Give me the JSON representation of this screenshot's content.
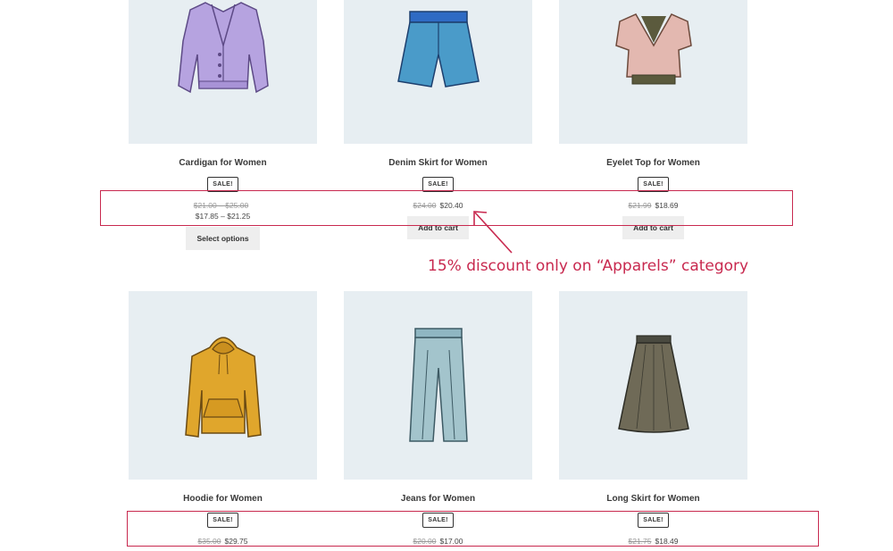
{
  "products": [
    {
      "title": "Cardigan for Women",
      "sale_badge": "SALE!",
      "old_price": "$21.00 – $25.00",
      "new_price": "$17.85 – $21.25",
      "button_label": "Select options",
      "icon": "cardigan-icon"
    },
    {
      "title": "Denim Skirt for Women",
      "sale_badge": "SALE!",
      "old_price": "$24.00",
      "new_price": "$20.40",
      "button_label": "Add to cart",
      "icon": "denim-shorts-icon"
    },
    {
      "title": "Eyelet Top for Women",
      "sale_badge": "SALE!",
      "old_price": "$21.99",
      "new_price": "$18.69",
      "button_label": "Add to cart",
      "icon": "eyelet-top-icon"
    },
    {
      "title": "Hoodie for Women",
      "sale_badge": "SALE!",
      "old_price": "$35.00",
      "new_price": "$29.75",
      "icon": "hoodie-icon"
    },
    {
      "title": "Jeans for Women",
      "sale_badge": "SALE!",
      "old_price": "$20.00",
      "new_price": "$17.00",
      "icon": "jeans-icon"
    },
    {
      "title": "Long Skirt for Women",
      "sale_badge": "SALE!",
      "old_price": "$21.75",
      "new_price": "$18.49",
      "icon": "long-skirt-icon"
    }
  ],
  "annotation": {
    "text": "15% discount only on “Apparels” category",
    "color": "#c8294f"
  },
  "colors": {
    "thumb_bg": "#e7eef2",
    "accent": "#c8294f"
  }
}
